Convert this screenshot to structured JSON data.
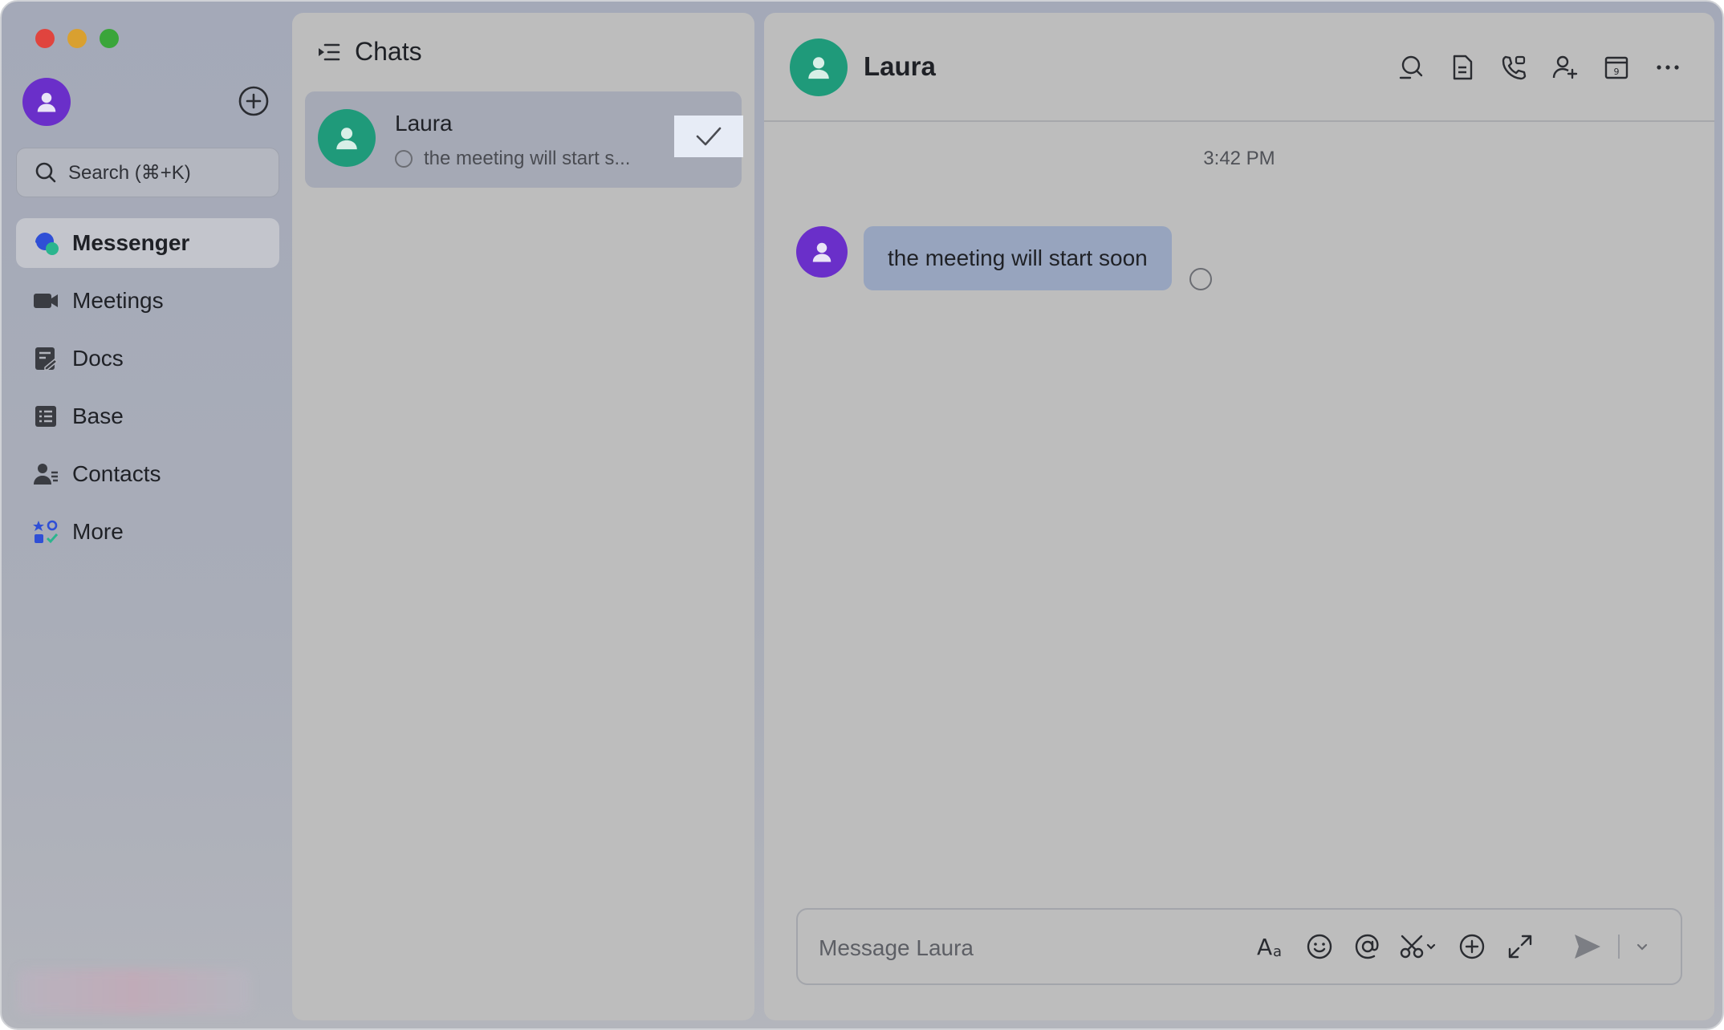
{
  "sidebar": {
    "search_placeholder": "Search (⌘+K)",
    "items": [
      {
        "label": "Messenger",
        "icon": "messenger-icon",
        "active": true
      },
      {
        "label": "Meetings",
        "icon": "video-camera-icon"
      },
      {
        "label": "Docs",
        "icon": "docs-icon"
      },
      {
        "label": "Base",
        "icon": "base-table-icon"
      },
      {
        "label": "Contacts",
        "icon": "contacts-icon"
      },
      {
        "label": "More",
        "icon": "apps-grid-icon"
      }
    ]
  },
  "chats": {
    "title": "Chats",
    "items": [
      {
        "name": "Laura",
        "preview": "the meeting will start s..."
      }
    ]
  },
  "conversation": {
    "title": "Laura",
    "timestamp": "3:42 PM",
    "messages": [
      {
        "text": "the meeting will start soon"
      }
    ],
    "composer_placeholder": "Message Laura"
  },
  "colors": {
    "accent_purple": "#6a2fc9",
    "accent_teal": "#1f9a7a",
    "bubble": "#97a4be"
  }
}
